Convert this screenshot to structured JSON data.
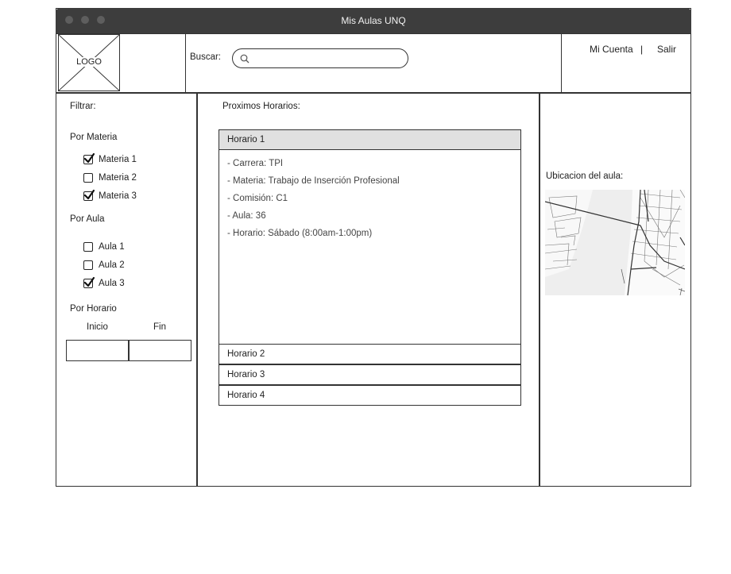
{
  "window": {
    "title": "Mis Aulas UNQ"
  },
  "header": {
    "logo_text": "LOGO",
    "search_label": "Buscar:",
    "search_value": "",
    "account_link": "Mi Cuenta",
    "separator": "|",
    "logout_link": "Salir"
  },
  "sidebar": {
    "filter_title": "Filtrar:",
    "materia_section": "Por Materia",
    "materias": [
      {
        "label": "Materia 1",
        "checked": true
      },
      {
        "label": "Materia 2",
        "checked": false
      },
      {
        "label": "Materia 3",
        "checked": true
      }
    ],
    "aula_section": "Por Aula",
    "aulas": [
      {
        "label": "Aula 1",
        "checked": false
      },
      {
        "label": "Aula 2",
        "checked": false
      },
      {
        "label": "Aula 3",
        "checked": true
      }
    ],
    "horario_section": "Por Horario",
    "inicio_label": "Inicio",
    "fin_label": "Fin",
    "inicio_value": "",
    "fin_value": ""
  },
  "main": {
    "title": "Proximos Horarios:",
    "horarios": [
      {
        "label": "Horario 1",
        "expanded": true
      },
      {
        "label": "Horario 2",
        "expanded": false
      },
      {
        "label": "Horario 3",
        "expanded": false
      },
      {
        "label": "Horario 4",
        "expanded": false
      }
    ],
    "details": [
      "- Carrera: TPI",
      "- Materia: Trabajo de Inserción Profesional",
      "- Comisión:  C1",
      "- Aula: 36",
      "- Horario: Sábado (8:00am-1:00pm)"
    ]
  },
  "right": {
    "map_title": "Ubicacion del aula:"
  },
  "colors": {
    "titlebar": "#3d3d3d",
    "expanded_header": "#e0e0e0",
    "map_bg": "#f0f0f0"
  }
}
